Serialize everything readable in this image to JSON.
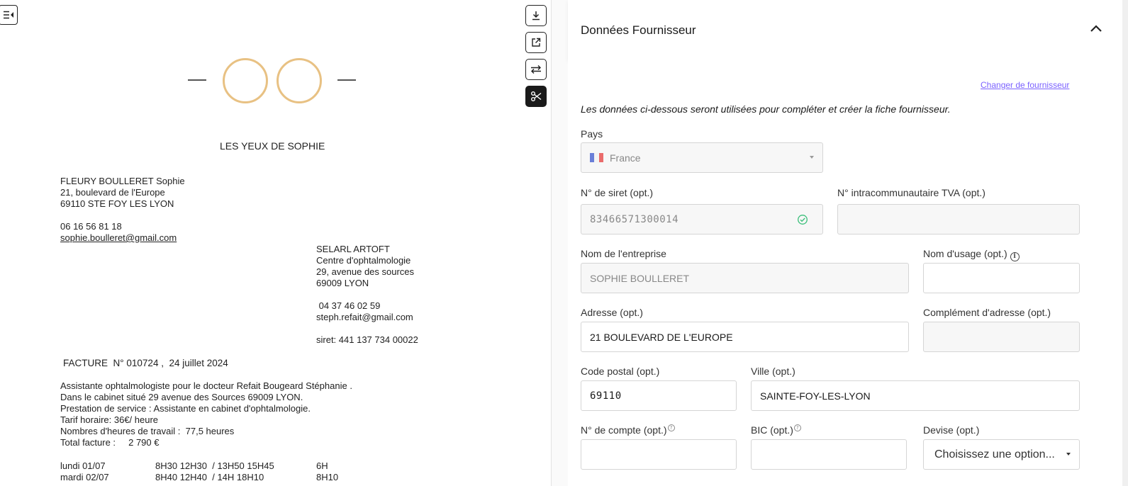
{
  "document": {
    "shop_name": "LES YEUX DE SOPHIE",
    "sender": {
      "name": "FLEURY BOULLERET Sophie",
      "address1": "21, boulevard de l'Europe",
      "address2": "69110 STE FOY LES LYON",
      "phone": "06 16 56 81 18",
      "email": "sophie.boulleret@gmail.com"
    },
    "recipient": {
      "name": "SELARL ARTOFT",
      "line1": "Centre d'ophtalmologie",
      "line2": "29, avenue des sources",
      "line3": "69009 LYON",
      "phone": " 04 37 46 02 59",
      "email": "steph.refait@gmail.com",
      "siret": "siret: 441 137 734 00022"
    },
    "invoice_title": "FACTURE  N° 010724 ,  24 juillet 2024",
    "body_lines": [
      "Assistante ophtalmologiste pour le docteur Refait Bougeard Stéphanie .",
      "Dans le cabinet situé 29 avenue des Sources 69009 LYON.",
      "Prestation de service : Assistante en cabinet d'ophtalmologie.",
      "Tarif horaire: 36€/ heure",
      "Nombres d'heures de travail :  77,5 heures",
      "Total facture :     2 790 €"
    ],
    "schedule": [
      {
        "day": "lundi 01/07",
        "hours": "8H30 12H30  / 13H50 15H45",
        "total": "6H"
      },
      {
        "day": "mardi 02/07",
        "hours": "8H40 12H40  / 14H 18H10",
        "total": "8H10"
      }
    ]
  },
  "toolbar": {
    "sidebar_toggle": "sidebar-toggle-icon",
    "download": "download-icon",
    "open_external": "external-link-icon",
    "swap": "swap-icon",
    "split": "scissors-icon"
  },
  "panel": {
    "title": "Données Fournisseur",
    "change_supplier_link": "Changer de fournisseur",
    "intro": "Les données ci-dessous seront utilisées pour compléter et créer la fiche fournisseur.",
    "fields": {
      "country_label": "Pays",
      "country_value": "France",
      "siret_label": "N° de siret (opt.)",
      "siret_value": "83466571300014",
      "vat_label": "N° intracommunautaire TVA (opt.)",
      "vat_value": "",
      "company_label": "Nom de l'entreprise",
      "company_value": "SOPHIE BOULLERET",
      "usage_name_label": "Nom d'usage (opt.)",
      "usage_name_value": "",
      "address_label": "Adresse (opt.)",
      "address_value": "21 BOULEVARD DE L'EUROPE",
      "address2_label": "Complément d'adresse (opt.)",
      "address2_value": "",
      "postal_label": "Code postal (opt.)",
      "postal_value": "69110",
      "city_label": "Ville (opt.)",
      "city_value": "SAINTE-FOY-LES-LYON",
      "account_label": "N° de compte (opt.)",
      "account_value": "",
      "bic_label": "BIC (opt.)",
      "bic_value": "",
      "currency_label": "Devise (opt.)",
      "currency_placeholder": "Choisissez une option..."
    }
  },
  "colors": {
    "accent_link": "#7b61ff",
    "logo_ring": "#e8c183",
    "valid_check": "#3bbf7a"
  }
}
